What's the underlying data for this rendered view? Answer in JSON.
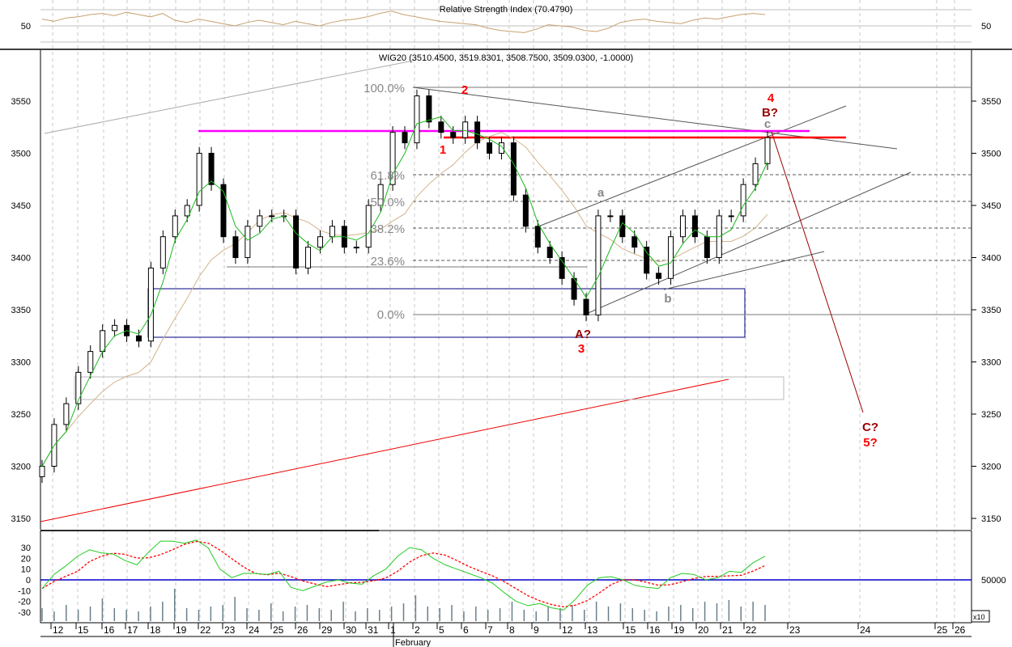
{
  "chart_data": {
    "type": "candlestick",
    "title": "WIG20 (3510.4500, 3519.8301, 3508.7500, 3509.0300, -1.0000)",
    "rsi": {
      "title": "Relative Strength Index (70.4790)",
      "level_label": "50",
      "values": [
        62,
        58,
        64,
        66,
        70,
        72,
        68,
        74,
        70,
        66,
        72,
        60,
        56,
        62,
        58,
        54,
        50,
        56,
        60,
        56,
        52,
        58,
        54,
        50,
        56,
        60,
        62,
        66,
        72,
        76,
        70,
        66,
        62,
        58,
        56,
        54,
        52,
        46,
        42,
        40,
        38,
        44,
        52,
        50,
        48,
        42,
        40,
        46,
        56,
        60,
        62,
        58,
        56,
        54,
        60,
        64,
        62,
        66,
        70,
        72,
        70
      ]
    },
    "price": {
      "y_ticks": [
        "3550",
        "3500",
        "3450",
        "3400",
        "3350",
        "3300",
        "3250",
        "3200",
        "3150"
      ],
      "ylim": [
        3130,
        3590
      ],
      "closes": [
        3200,
        3240,
        3260,
        3290,
        3310,
        3330,
        3335,
        3325,
        3320,
        3390,
        3420,
        3440,
        3450,
        3500,
        3470,
        3420,
        3400,
        3430,
        3440,
        3440,
        3440,
        3390,
        3410,
        3420,
        3430,
        3410,
        3410,
        3450,
        3470,
        3520,
        3510,
        3555,
        3530,
        3520,
        3515,
        3530,
        3510,
        3500,
        3510,
        3460,
        3430,
        3410,
        3400,
        3380,
        3360,
        3345,
        3440,
        3440,
        3420,
        3410,
        3385,
        3380,
        3420,
        3440,
        3420,
        3400,
        3440,
        3440,
        3470,
        3490,
        3515
      ]
    },
    "fibonacci": [
      "100.0%",
      "61.8%",
      "50.0%",
      "38.2%",
      "23.6%",
      "0.0%"
    ],
    "wave_labels": {
      "w1": "1",
      "w2": "2",
      "w3": "3",
      "w4": "4",
      "a_cap": "A?",
      "b_cap": "B?",
      "c_cap": "C?",
      "w5": "5?",
      "a": "a",
      "b": "b",
      "c": "c"
    },
    "oscillator": {
      "y_ticks": [
        "30",
        "20",
        "10",
        "0",
        "-10",
        "-20",
        "-30"
      ],
      "volume_label": "50000",
      "volume_scale": "x10",
      "values": [
        -8,
        5,
        13,
        22,
        28,
        25,
        24,
        18,
        14,
        26,
        36,
        36,
        34,
        37,
        30,
        10,
        2,
        6,
        6,
        5,
        8,
        -7,
        -10,
        -6,
        -2,
        0,
        -3,
        -4,
        4,
        10,
        22,
        30,
        28,
        20,
        14,
        10,
        6,
        2,
        -3,
        -12,
        -20,
        -24,
        -22,
        -26,
        -28,
        -18,
        -5,
        2,
        3,
        0,
        -5,
        -7,
        -8,
        2,
        6,
        5,
        0,
        2,
        8,
        7,
        16,
        22
      ],
      "volume": [
        8,
        6,
        10,
        7,
        9,
        14,
        8,
        7,
        6,
        9,
        12,
        20,
        8,
        7,
        9,
        10,
        15,
        8,
        7,
        11,
        6,
        9,
        10,
        8,
        7,
        12,
        6,
        8,
        7,
        9,
        11,
        16,
        9,
        8,
        10,
        6,
        9,
        7,
        8,
        12,
        7,
        6,
        9,
        8,
        10,
        7,
        12,
        9,
        11,
        8,
        7,
        6,
        9,
        10,
        8,
        12,
        11,
        13,
        9,
        12,
        10
      ]
    },
    "x_ticks": [
      "12",
      "15",
      "16",
      "17",
      "18",
      "19",
      "22",
      "23",
      "24",
      "25",
      "26",
      "29",
      "30",
      "31",
      "1",
      "2",
      "5",
      "6",
      "7",
      "8",
      "9",
      "12",
      "13",
      "15",
      "16",
      "19",
      "20",
      "21",
      "22",
      "23",
      "24",
      "25",
      "26"
    ],
    "month_label": "February"
  }
}
